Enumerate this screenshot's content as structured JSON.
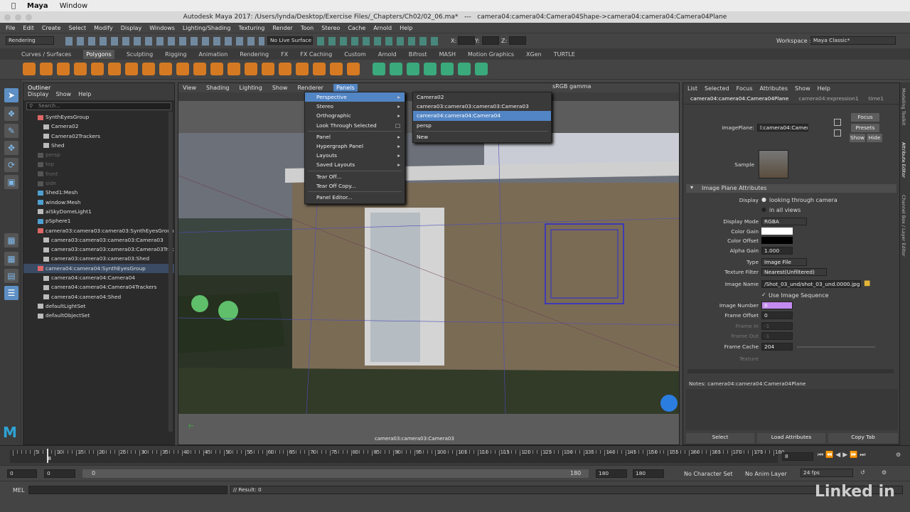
{
  "mac_menu": {
    "app": "Maya",
    "window": "Window"
  },
  "window_title": "Autodesk Maya 2017: /Users/lynda/Desktop/Exercise Files/_Chapters/Ch02/02_06.ma*   ---   camera04:camera04:Camera04Shape->camera04:camera04:Camera04Plane",
  "main_menu": [
    "File",
    "Edit",
    "Create",
    "Select",
    "Modify",
    "Display",
    "Windows",
    "Lighting/Shading",
    "Texturing",
    "Render",
    "Toon",
    "Stereo",
    "Cache",
    "Arnold",
    "Help"
  ],
  "status_line": {
    "menu_set": "Rendering",
    "live_surface": "No Live Surface",
    "x": "X:",
    "y": "Y:",
    "z": "Z:",
    "workspace_label": "Workspace :",
    "workspace_value": "Maya Classic*"
  },
  "shelf_tabs": [
    "Curves / Surfaces",
    "Polygons",
    "Sculpting",
    "Rigging",
    "Animation",
    "Rendering",
    "FX",
    "FX Caching",
    "Custom",
    "Arnold",
    "Bifrost",
    "MASH",
    "Motion Graphics",
    "XGen",
    "TURTLE"
  ],
  "shelf_active": "Polygons",
  "outliner": {
    "title": "Outliner",
    "menus": [
      "Display",
      "Show",
      "Help"
    ],
    "search_placeholder": "Search...",
    "rows": [
      {
        "label": "SynthEyesGroup",
        "indent": 0,
        "dim": false,
        "sel": false
      },
      {
        "label": "Camera02",
        "indent": 1,
        "dim": false,
        "sel": false
      },
      {
        "label": "Camera02Trackers",
        "indent": 1,
        "dim": false,
        "sel": false
      },
      {
        "label": "Shed",
        "indent": 1,
        "dim": false,
        "sel": false
      },
      {
        "label": "persp",
        "indent": 0,
        "dim": true,
        "sel": false
      },
      {
        "label": "top",
        "indent": 0,
        "dim": true,
        "sel": false
      },
      {
        "label": "front",
        "indent": 0,
        "dim": true,
        "sel": false
      },
      {
        "label": "side",
        "indent": 0,
        "dim": true,
        "sel": false
      },
      {
        "label": "Shed1:Mesh",
        "indent": 0,
        "dim": false,
        "sel": false
      },
      {
        "label": "window:Mesh",
        "indent": 0,
        "dim": false,
        "sel": false
      },
      {
        "label": "aiSkyDomeLight1",
        "indent": 0,
        "dim": false,
        "sel": false
      },
      {
        "label": "pSphere1",
        "indent": 0,
        "dim": false,
        "sel": false
      },
      {
        "label": "camera03:camera03:camera03:SynthEyesGroup",
        "indent": 0,
        "dim": false,
        "sel": false
      },
      {
        "label": "camera03:camera03:camera03:Camera03",
        "indent": 1,
        "dim": false,
        "sel": false
      },
      {
        "label": "camera03:camera03:camera03:Camera03Trackers",
        "indent": 1,
        "dim": false,
        "sel": false
      },
      {
        "label": "camera03:camera03:camera03:Shed",
        "indent": 1,
        "dim": false,
        "sel": false
      },
      {
        "label": "camera04:camera04:SynthEyesGroup",
        "indent": 0,
        "dim": false,
        "sel": true
      },
      {
        "label": "camera04:camera04:Camera04",
        "indent": 1,
        "dim": false,
        "sel": false
      },
      {
        "label": "camera04:camera04:Camera04Trackers",
        "indent": 1,
        "dim": false,
        "sel": false
      },
      {
        "label": "camera04:camera04:Shed",
        "indent": 1,
        "dim": false,
        "sel": false
      },
      {
        "label": "defaultLightSet",
        "indent": 0,
        "dim": false,
        "sel": false
      },
      {
        "label": "defaultObjectSet",
        "indent": 0,
        "dim": false,
        "sel": false
      }
    ]
  },
  "viewport": {
    "menus": [
      "View",
      "Shading",
      "Lighting",
      "Show",
      "Renderer",
      "Panels"
    ],
    "active_menu": "Panels",
    "gamma": "sRGB gamma",
    "camera_label": "camera03:camera03:Camera03"
  },
  "panels_menu": {
    "items": [
      {
        "label": "Perspective",
        "arrow": true,
        "hl": true
      },
      {
        "label": "Stereo",
        "arrow": true
      },
      {
        "label": "Orthographic",
        "arrow": true
      },
      {
        "label": "Look Through Selected",
        "box": true
      },
      {
        "sep": true
      },
      {
        "label": "Panel",
        "arrow": true
      },
      {
        "label": "Hypergraph Panel",
        "arrow": true
      },
      {
        "label": "Layouts",
        "arrow": true
      },
      {
        "label": "Saved Layouts",
        "arrow": true
      },
      {
        "sep": true
      },
      {
        "label": "Tear Off..."
      },
      {
        "label": "Tear Off Copy..."
      },
      {
        "sep": true
      },
      {
        "label": "Panel Editor..."
      }
    ]
  },
  "perspective_submenu": {
    "items": [
      {
        "label": "Camera02"
      },
      {
        "label": "camera03:camera03:camera03:Camera03"
      },
      {
        "label": "camera04:camera04:Camera04",
        "hl": true
      },
      {
        "label": "persp"
      },
      {
        "sep": true
      },
      {
        "label": "New"
      }
    ]
  },
  "attribute_editor": {
    "menus": [
      "List",
      "Selected",
      "Focus",
      "Attributes",
      "Show",
      "Help"
    ],
    "tabs": [
      "camera04:camera04:Camera04Plane",
      "camera04:expression1",
      "time1"
    ],
    "image_plane_label": "imagePlane:",
    "image_plane_value": "l:camera04:Camera04Plane",
    "buttons": {
      "focus": "Focus",
      "presets": "Presets",
      "show": "Show",
      "hide": "Hide"
    },
    "sample_label": "Sample",
    "section": "Image Plane Attributes",
    "display_label": "Display",
    "display_opt1": "looking through camera",
    "display_opt2": "in all views",
    "display_mode_label": "Display Mode",
    "display_mode": "RGBA",
    "color_gain_label": "Color Gain",
    "color_offset_label": "Color Offset",
    "alpha_gain_label": "Alpha Gain",
    "alpha_gain": "1.000",
    "type_label": "Type",
    "type": "Image File",
    "texture_filter_label": "Texture Filter",
    "texture_filter": "Nearest(Unfiltered)",
    "image_name_label": "Image Name",
    "image_name": "/Shot_03_und/shot_03_und.0000.jpg",
    "use_sequence": "Use Image Sequence",
    "image_number_label": "Image Number",
    "image_number": "8",
    "frame_offset_label": "Frame Offset",
    "frame_offset": "0",
    "frame_in_label": "Frame In",
    "frame_in": "-1",
    "frame_out_label": "Frame Out",
    "frame_out": "-1",
    "frame_cache_label": "Frame Cache",
    "frame_cache": "204",
    "texture_label": "Texture",
    "notes": "Notes:  camera04:camera04:Camera04Plane",
    "footer": [
      "Select",
      "Load Attributes",
      "Copy Tab"
    ]
  },
  "side_tabs": [
    "Modeling Toolkit",
    "Attribute Editor",
    "Channel Box / Layer Editor"
  ],
  "timeline": {
    "labels": [
      "5",
      "10",
      "15",
      "20",
      "25",
      "30",
      "35",
      "40",
      "45",
      "50",
      "55",
      "60",
      "65",
      "70",
      "75",
      "80",
      "85",
      "90",
      "95",
      "100",
      "105",
      "110",
      "115",
      "120",
      "125",
      "130",
      "135",
      "140",
      "145",
      "150",
      "155",
      "160",
      "165",
      "170",
      "175",
      "180"
    ],
    "current_marker": "8",
    "current_frame": "8"
  },
  "range": {
    "start": "0",
    "anim_start": "0",
    "inner_start": "0",
    "inner_end": "180",
    "anim_end": "180",
    "end": "180",
    "character_set": "No Character Set",
    "anim_layer": "No Anim Layer",
    "fps": "24 fps"
  },
  "command": {
    "label": "MEL",
    "result": "// Result: 0"
  },
  "watermark": "Linked in",
  "colors": {
    "highlight": "#5285c4",
    "orange_icon": "#d57a22",
    "green_icon": "#3aa97b",
    "image_number_bg": "#c38bf0"
  }
}
